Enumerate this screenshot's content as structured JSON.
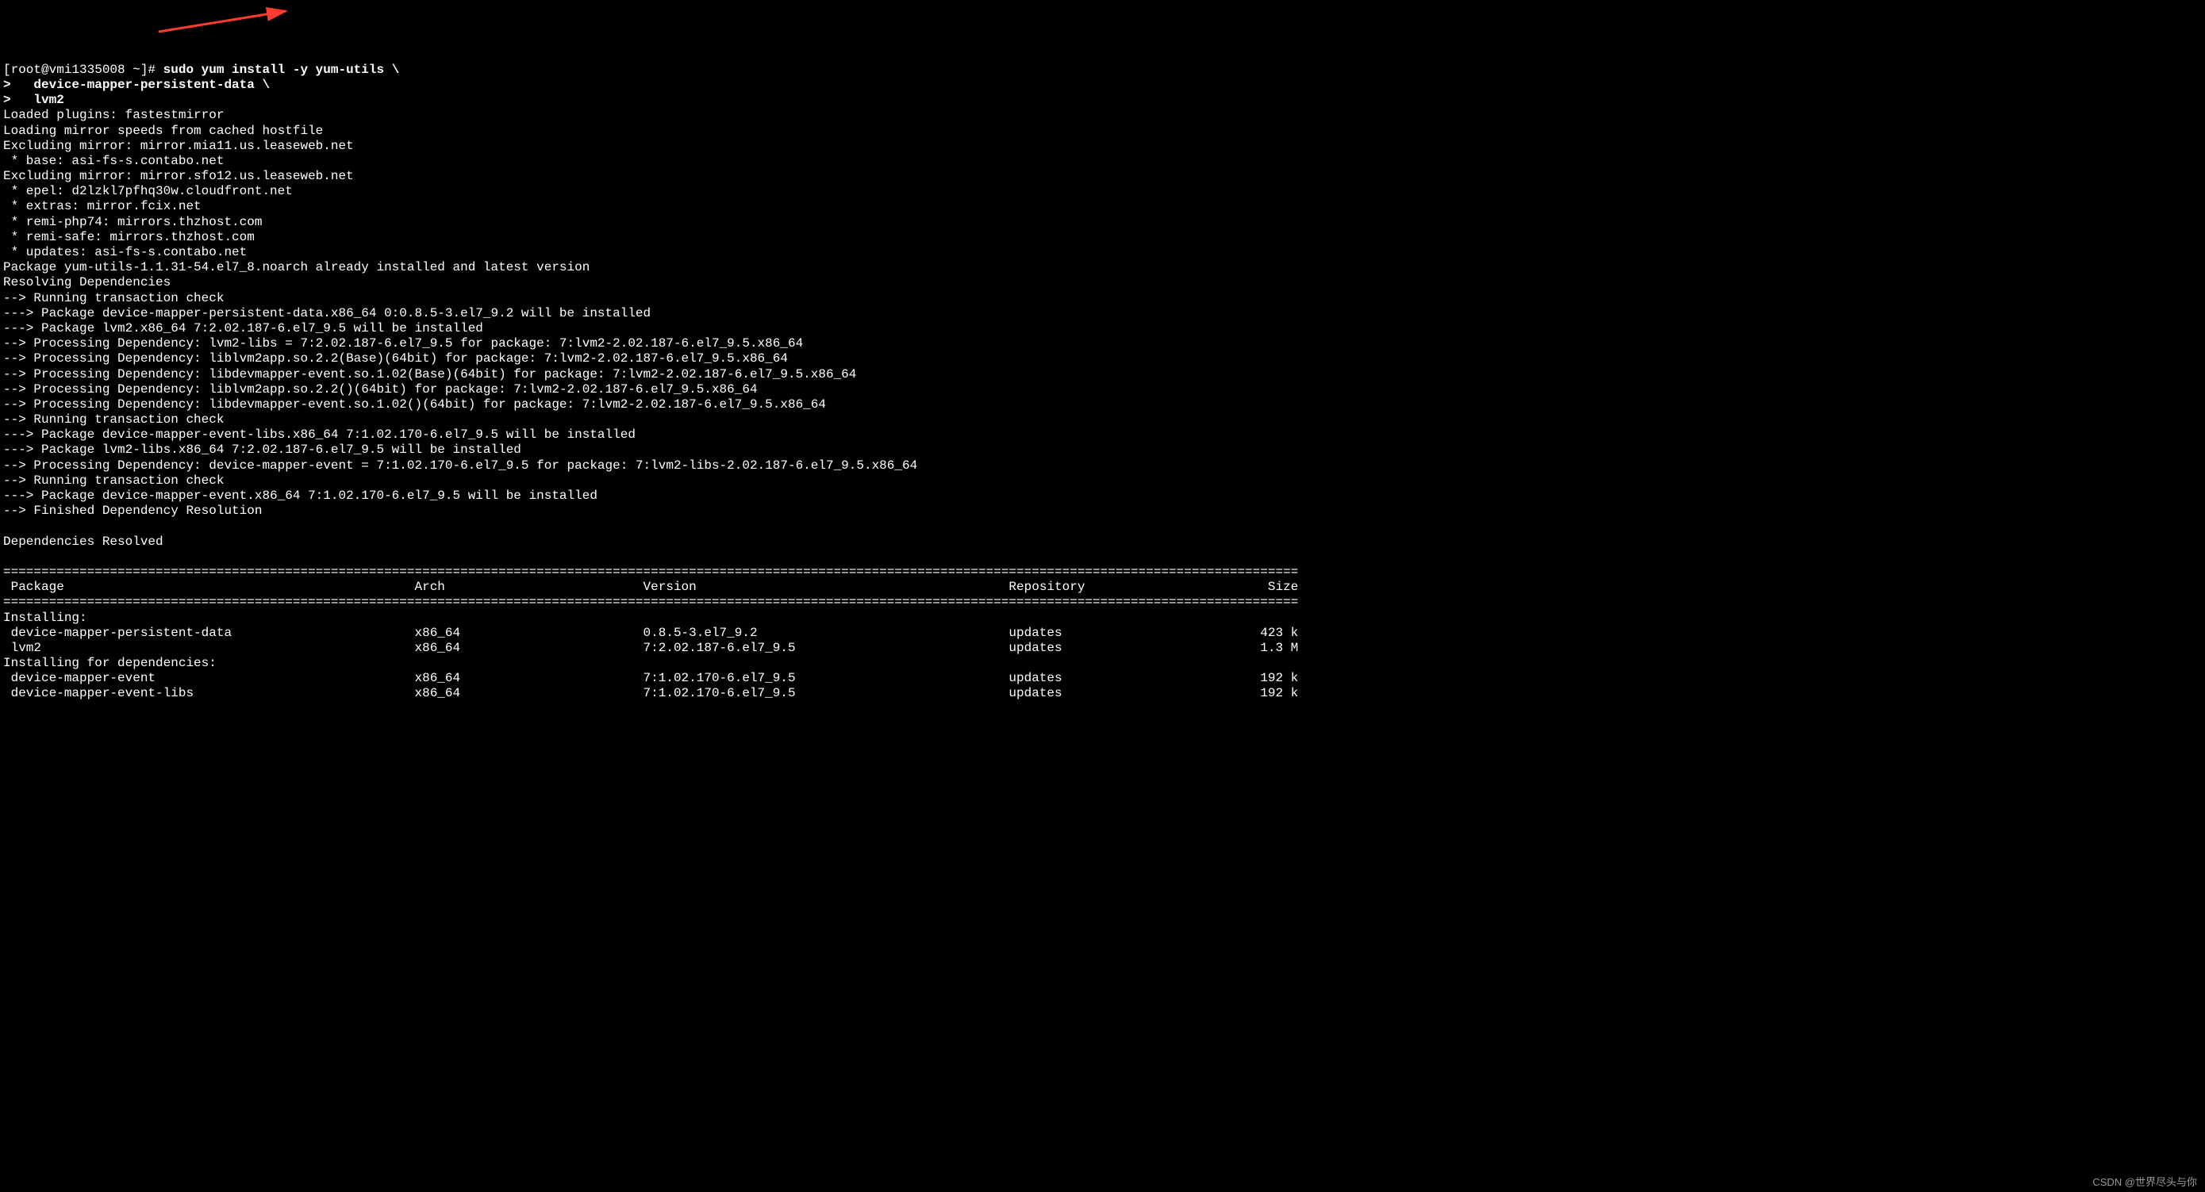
{
  "prompt": {
    "line1_prefix": "[root@vmi1335008 ~]# ",
    "line1_cmd": "sudo yum install -y yum-utils \\",
    "line2": ">   device-mapper-persistent-data \\",
    "line3": ">   lvm2"
  },
  "output_lines": [
    "Loaded plugins: fastestmirror",
    "Loading mirror speeds from cached hostfile",
    "Excluding mirror: mirror.mia11.us.leaseweb.net",
    " * base: asi-fs-s.contabo.net",
    "Excluding mirror: mirror.sfo12.us.leaseweb.net",
    " * epel: d2lzkl7pfhq30w.cloudfront.net",
    " * extras: mirror.fcix.net",
    " * remi-php74: mirrors.thzhost.com",
    " * remi-safe: mirrors.thzhost.com",
    " * updates: asi-fs-s.contabo.net",
    "Package yum-utils-1.1.31-54.el7_8.noarch already installed and latest version",
    "Resolving Dependencies",
    "--> Running transaction check",
    "---> Package device-mapper-persistent-data.x86_64 0:0.8.5-3.el7_9.2 will be installed",
    "---> Package lvm2.x86_64 7:2.02.187-6.el7_9.5 will be installed",
    "--> Processing Dependency: lvm2-libs = 7:2.02.187-6.el7_9.5 for package: 7:lvm2-2.02.187-6.el7_9.5.x86_64",
    "--> Processing Dependency: liblvm2app.so.2.2(Base)(64bit) for package: 7:lvm2-2.02.187-6.el7_9.5.x86_64",
    "--> Processing Dependency: libdevmapper-event.so.1.02(Base)(64bit) for package: 7:lvm2-2.02.187-6.el7_9.5.x86_64",
    "--> Processing Dependency: liblvm2app.so.2.2()(64bit) for package: 7:lvm2-2.02.187-6.el7_9.5.x86_64",
    "--> Processing Dependency: libdevmapper-event.so.1.02()(64bit) for package: 7:lvm2-2.02.187-6.el7_9.5.x86_64",
    "--> Running transaction check",
    "---> Package device-mapper-event-libs.x86_64 7:1.02.170-6.el7_9.5 will be installed",
    "---> Package lvm2-libs.x86_64 7:2.02.187-6.el7_9.5 will be installed",
    "--> Processing Dependency: device-mapper-event = 7:1.02.170-6.el7_9.5 for package: 7:lvm2-libs-2.02.187-6.el7_9.5.x86_64",
    "--> Running transaction check",
    "---> Package device-mapper-event.x86_64 7:1.02.170-6.el7_9.5 will be installed",
    "--> Finished Dependency Resolution",
    "",
    "Dependencies Resolved",
    ""
  ],
  "table": {
    "separator_char": "=",
    "headers": {
      "package": " Package",
      "arch": "Arch",
      "version": "Version",
      "repository": "Repository",
      "size": "Size"
    },
    "section1": "Installing:",
    "section2": "Installing for dependencies:",
    "rows_installing": [
      {
        "pkg": " device-mapper-persistent-data",
        "arch": "x86_64",
        "ver": "0.8.5-3.el7_9.2",
        "repo": "updates",
        "size": "423 k"
      },
      {
        "pkg": " lvm2",
        "arch": "x86_64",
        "ver": "7:2.02.187-6.el7_9.5",
        "repo": "updates",
        "size": "1.3 M"
      }
    ],
    "rows_deps": [
      {
        "pkg": " device-mapper-event",
        "arch": "x86_64",
        "ver": "7:1.02.170-6.el7_9.5",
        "repo": "updates",
        "size": "192 k"
      },
      {
        "pkg": " device-mapper-event-libs",
        "arch": "x86_64",
        "ver": "7:1.02.170-6.el7_9.5",
        "repo": "updates",
        "size": "192 k"
      }
    ]
  },
  "watermark": "CSDN @世界尽头与你",
  "arrow_color": "#ff3b30"
}
